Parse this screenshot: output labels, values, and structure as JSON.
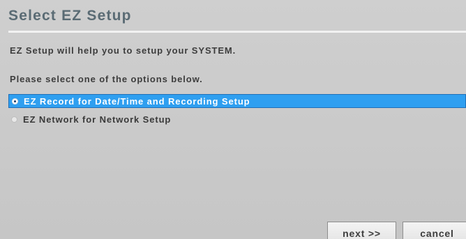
{
  "dialog": {
    "title": "Select EZ Setup",
    "intro": "EZ Setup will help you to setup your SYSTEM.",
    "prompt": "Please select one of the options below.",
    "options": [
      {
        "label": "EZ Record for Date/Time and Recording Setup",
        "selected": true
      },
      {
        "label": "EZ Network for Network Setup",
        "selected": false
      }
    ],
    "buttons": {
      "next": "next >>",
      "cancel": "cancel"
    }
  },
  "colors": {
    "selection": "#2f9ff0",
    "title": "#5a6b74",
    "background": "#c9c9c9"
  }
}
